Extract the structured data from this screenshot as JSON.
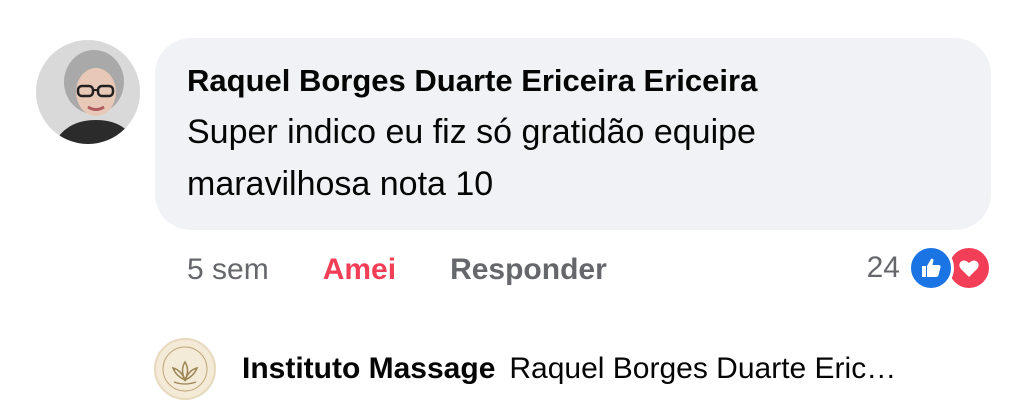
{
  "comment": {
    "author": "Raquel Borges Duarte Ericeira Ericeira",
    "text_line1": "Super indico eu fiz só gratidão equipe",
    "text_line2": "maravilhosa nota 10",
    "avatar_icon": "user-photo-avatar",
    "actions": {
      "time": "5 sem",
      "reaction_label": "Amei",
      "reply_label": "Responder"
    },
    "reactions": {
      "count": "24",
      "icons": [
        "like-icon",
        "heart-icon"
      ],
      "colors": {
        "like": "#1b74e4",
        "love": "#f33e58"
      }
    }
  },
  "reply_preview": {
    "author": "Instituto Massage",
    "snippet": "Raquel Borges Duarte Eric…",
    "avatar_icon": "lotus-logo-avatar"
  },
  "colors": {
    "bubble_bg": "#f0f2f5",
    "secondary_text": "#65676b",
    "love_accent": "#f33e58"
  }
}
